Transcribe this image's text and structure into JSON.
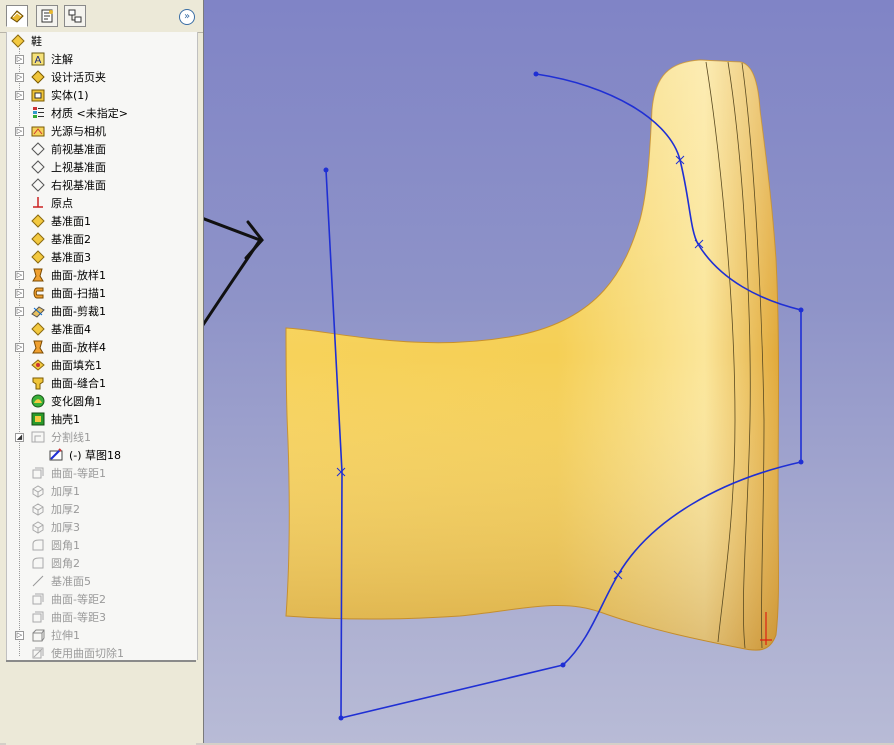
{
  "colors": {
    "panel_bg": "#ece9d8",
    "viewport_top": "#8084c6",
    "viewport_bottom": "#b8bbd6",
    "sketch": "#1f2fd4",
    "boot": "#f2c24a"
  },
  "tabs": [
    {
      "name": "feature-manager-tab",
      "icon": "feature-tree-icon"
    },
    {
      "name": "property-manager-tab",
      "icon": "property-icon"
    },
    {
      "name": "configuration-manager-tab",
      "icon": "configuration-icon"
    }
  ],
  "tree": {
    "root": "鞋",
    "items": [
      {
        "label": "注解",
        "icon": "annotation-icon",
        "expander": true,
        "state": "normal"
      },
      {
        "label": "设计活页夹",
        "icon": "design-binder-icon",
        "expander": true,
        "state": "normal"
      },
      {
        "label": "实体(1)",
        "icon": "solid-bodies-icon",
        "expander": true,
        "state": "normal"
      },
      {
        "label": "材质 <未指定>",
        "icon": "material-icon",
        "expander": false,
        "state": "normal"
      },
      {
        "label": "光源与相机",
        "icon": "lights-camera-icon",
        "expander": true,
        "state": "normal"
      },
      {
        "label": "前视基准面",
        "icon": "plane-icon",
        "expander": false,
        "state": "normal"
      },
      {
        "label": "上视基准面",
        "icon": "plane-icon",
        "expander": false,
        "state": "normal"
      },
      {
        "label": "右视基准面",
        "icon": "plane-icon",
        "expander": false,
        "state": "normal"
      },
      {
        "label": "原点",
        "icon": "origin-icon",
        "expander": false,
        "state": "normal"
      },
      {
        "label": "基准面1",
        "icon": "ref-plane-icon",
        "expander": false,
        "state": "normal"
      },
      {
        "label": "基准面2",
        "icon": "ref-plane-icon",
        "expander": false,
        "state": "normal"
      },
      {
        "label": "基准面3",
        "icon": "ref-plane-icon",
        "expander": false,
        "state": "normal"
      },
      {
        "label": "曲面-放样1",
        "icon": "surface-loft-icon",
        "expander": true,
        "state": "normal"
      },
      {
        "label": "曲面-扫描1",
        "icon": "surface-sweep-icon",
        "expander": true,
        "state": "normal"
      },
      {
        "label": "曲面-剪裁1",
        "icon": "surface-trim-icon",
        "expander": true,
        "state": "normal"
      },
      {
        "label": "基准面4",
        "icon": "ref-plane-icon",
        "expander": false,
        "state": "normal"
      },
      {
        "label": "曲面-放样4",
        "icon": "surface-loft-icon",
        "expander": true,
        "state": "normal"
      },
      {
        "label": "曲面填充1",
        "icon": "surface-fill-icon",
        "expander": false,
        "state": "normal"
      },
      {
        "label": "曲面-缝合1",
        "icon": "surface-knit-icon",
        "expander": false,
        "state": "normal"
      },
      {
        "label": "变化圆角1",
        "icon": "variable-fillet-icon",
        "expander": false,
        "state": "normal"
      },
      {
        "label": "抽壳1",
        "icon": "shell-icon",
        "expander": false,
        "state": "normal"
      },
      {
        "label": "分割线1",
        "icon": "split-line-icon",
        "expander": true,
        "expanded": true,
        "state": "gray"
      },
      {
        "label": "(-) 草图18",
        "icon": "sketch-icon",
        "expander": false,
        "indent": 1,
        "state": "normal"
      },
      {
        "label": "曲面-等距1",
        "icon": "surface-offset-icon",
        "expander": false,
        "state": "gray"
      },
      {
        "label": "加厚1",
        "icon": "thicken-icon",
        "expander": false,
        "state": "gray"
      },
      {
        "label": "加厚2",
        "icon": "thicken-icon",
        "expander": false,
        "state": "gray"
      },
      {
        "label": "加厚3",
        "icon": "thicken-icon",
        "expander": false,
        "state": "gray"
      },
      {
        "label": "圆角1",
        "icon": "fillet-icon",
        "expander": false,
        "state": "gray"
      },
      {
        "label": "圆角2",
        "icon": "fillet-icon",
        "expander": false,
        "state": "gray"
      },
      {
        "label": "基准面5",
        "icon": "plane-gray-icon",
        "expander": false,
        "state": "gray"
      },
      {
        "label": "曲面-等距2",
        "icon": "surface-offset-icon",
        "expander": false,
        "state": "gray"
      },
      {
        "label": "曲面-等距3",
        "icon": "surface-offset-icon",
        "expander": false,
        "state": "gray"
      },
      {
        "label": "拉伸1",
        "icon": "extrude-icon",
        "expander": true,
        "state": "gray"
      },
      {
        "label": "使用曲面切除1",
        "icon": "surface-cut-icon",
        "expander": false,
        "state": "gray"
      }
    ]
  }
}
